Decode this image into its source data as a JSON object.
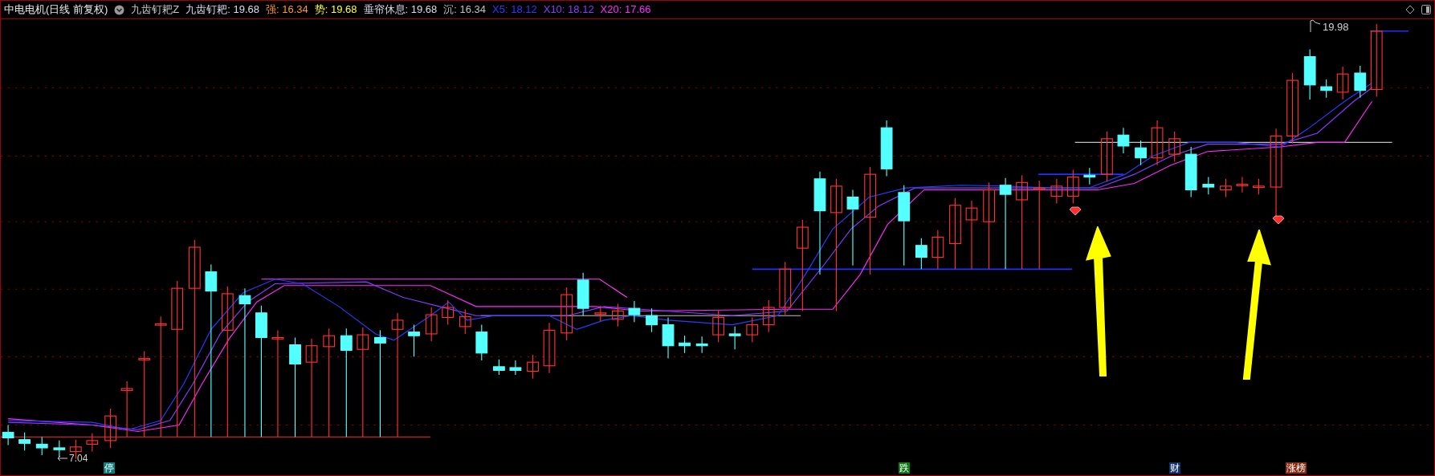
{
  "header": {
    "title": "中电电机(日线 前复权)",
    "indicator": "九齿钉耙Z",
    "values": [
      {
        "label": "九齿钉耙:",
        "value": "19.68"
      },
      {
        "label": "强:",
        "value": "16.34"
      },
      {
        "label": "势:",
        "value": "19.68"
      },
      {
        "label": "垂帘休息:",
        "value": "19.68"
      },
      {
        "label": "沉:",
        "value": "16.34"
      },
      {
        "label": "X5:",
        "value": "18.12"
      },
      {
        "label": "X10:",
        "value": "18.12"
      },
      {
        "label": "X20:",
        "value": "17.66"
      }
    ]
  },
  "price_labels": [
    {
      "kind": "high",
      "text": "19.98"
    },
    {
      "kind": "low",
      "text": "7.04"
    }
  ],
  "signals": [
    {
      "text": "停",
      "color": "#0b7f80"
    },
    {
      "text": "跌",
      "color": "#0d7a12"
    },
    {
      "text": "财",
      "color": "#10306e"
    },
    {
      "text": "涨榜",
      "color": "#8a2c12"
    }
  ]
}
